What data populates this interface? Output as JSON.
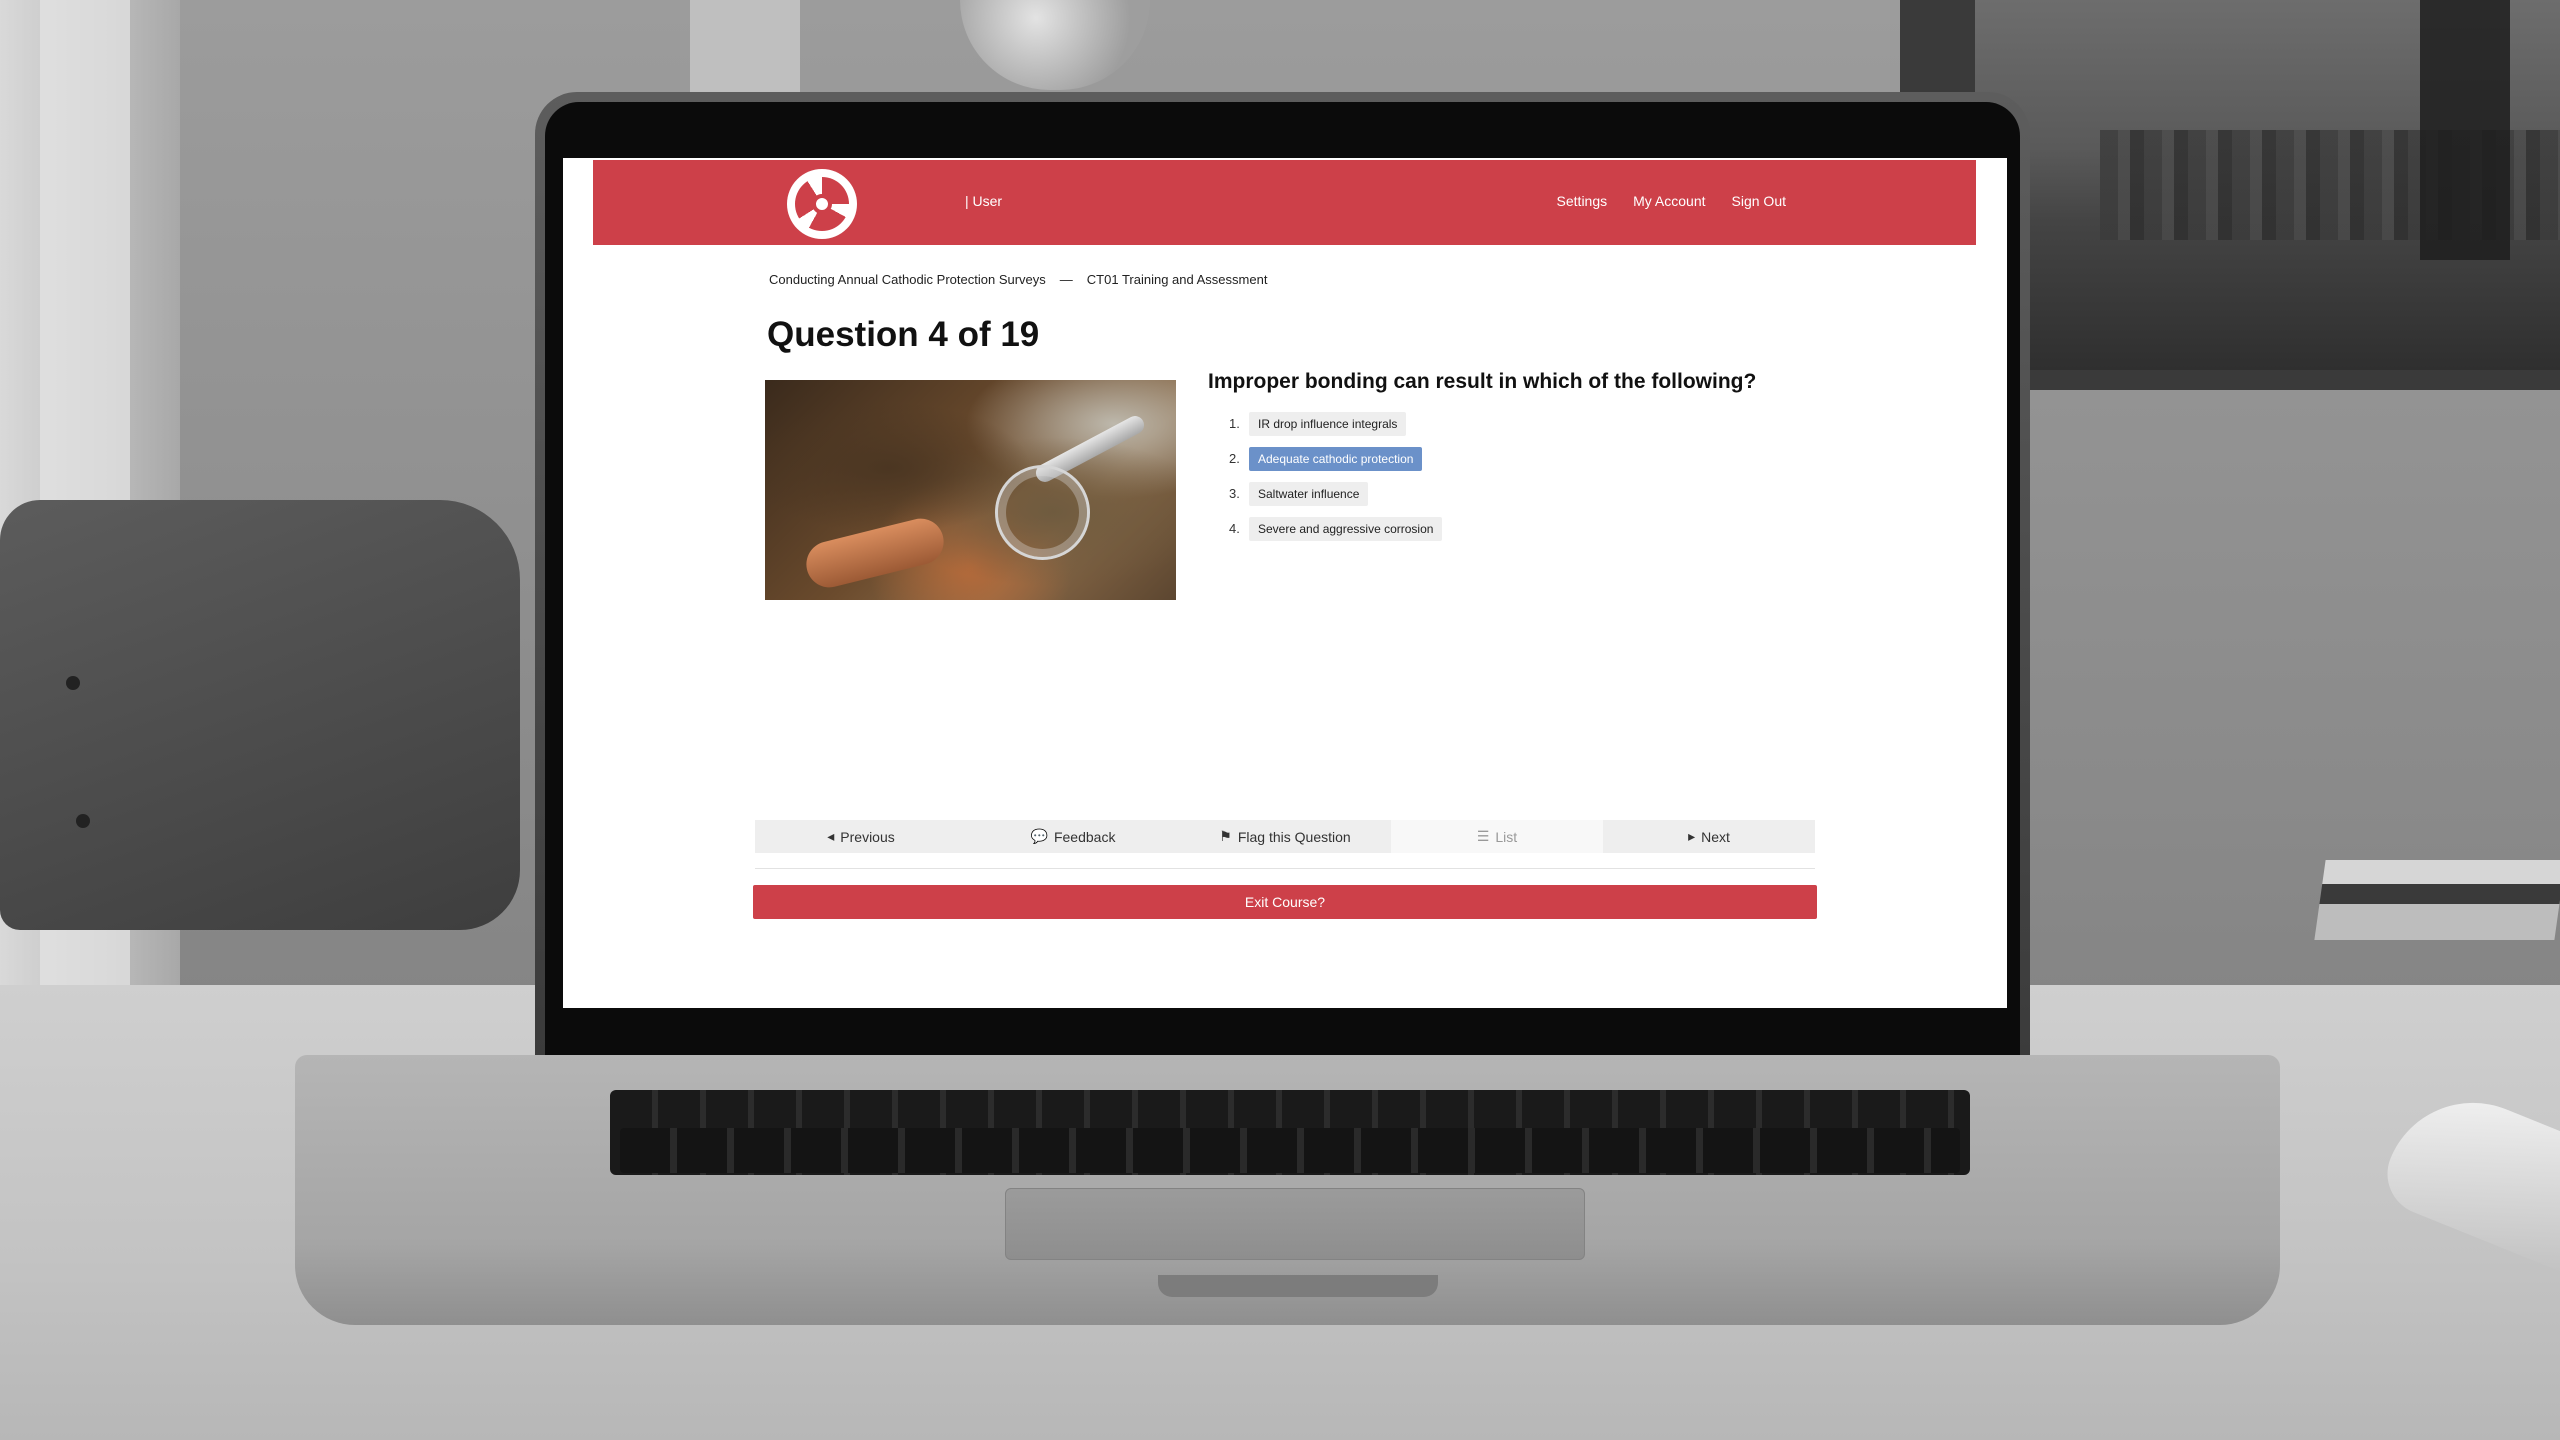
{
  "header": {
    "user_label": "| User",
    "nav": [
      "Settings",
      "My Account",
      "Sign Out"
    ]
  },
  "breadcrumb": {
    "course": "Conducting Annual Cathodic Protection Surveys",
    "separator": "—",
    "module": "CT01 Training and Assessment"
  },
  "quiz": {
    "title": "Question 4 of 19",
    "question": "Improper bonding can result in which of the following?",
    "answers": [
      {
        "num": "1.",
        "text": "IR drop influence integrals"
      },
      {
        "num": "2.",
        "text": "Adequate cathodic protection"
      },
      {
        "num": "3.",
        "text": "Saltwater influence"
      },
      {
        "num": "4.",
        "text": "Severe and aggressive corrosion"
      }
    ],
    "selected_answer_index": 1
  },
  "toolbar": {
    "previous": "Previous",
    "feedback": "Feedback",
    "flag": "Flag this Question",
    "list": "List",
    "next": "Next"
  },
  "exit_label": "Exit Course?",
  "colors": {
    "brand_red": "#cd4049",
    "selected_blue": "#6b91c9"
  }
}
